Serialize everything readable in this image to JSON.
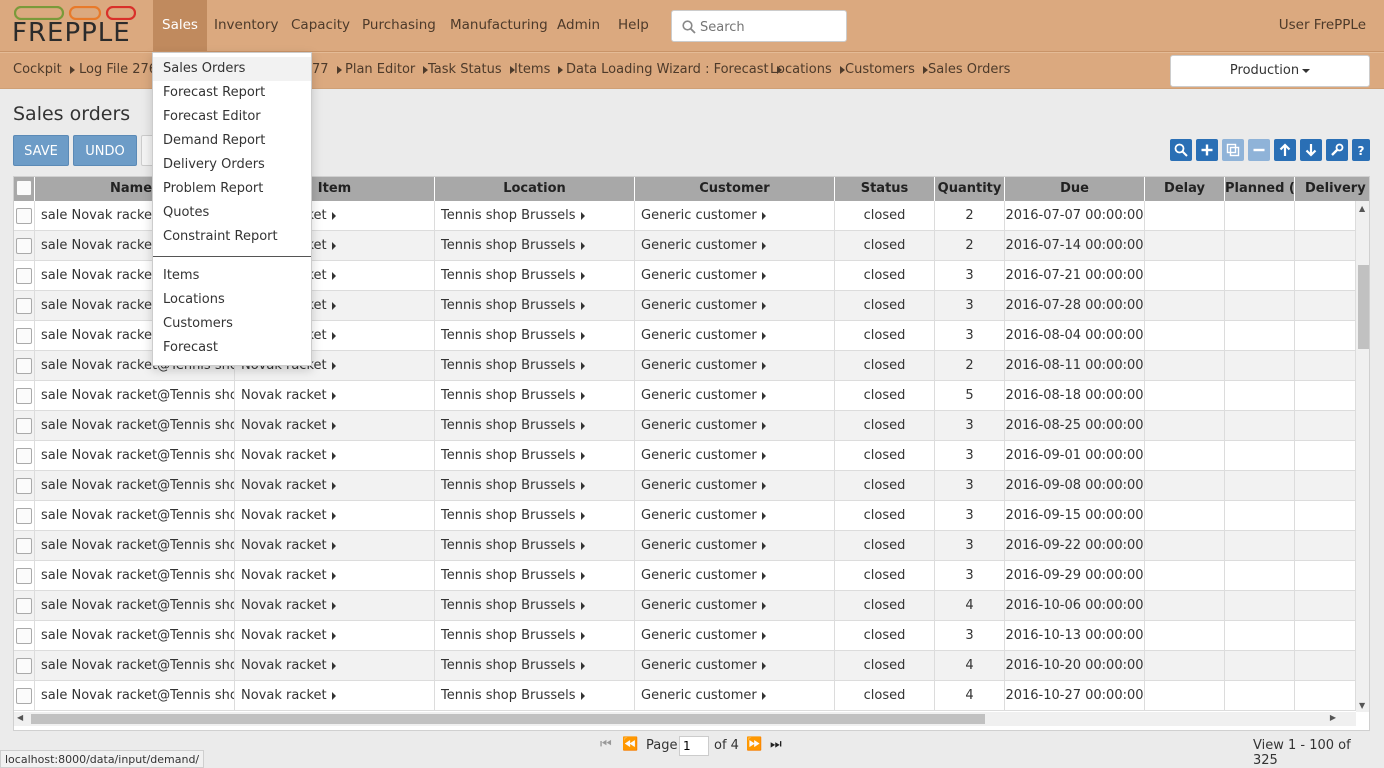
{
  "app": {
    "logo_text": "FREPPLE",
    "logo_ring_colors": [
      "#7a9a3a",
      "#e87a2a",
      "#d9302a"
    ]
  },
  "nav": {
    "items": [
      "Sales",
      "Inventory",
      "Capacity",
      "Purchasing",
      "Manufacturing",
      "Admin",
      "Help"
    ],
    "active": "Sales",
    "search_placeholder": "Search",
    "user": "User FrePPLe"
  },
  "breadcrumbs": {
    "items": [
      "Cockpit",
      "Log File 276",
      "77",
      "Plan Editor",
      "Task Status",
      "Items",
      "Data Loading Wizard : Forecast",
      "Locations",
      "Customers",
      "Sales Orders"
    ],
    "scenario": "Production"
  },
  "page": {
    "title": "Sales orders",
    "save_label": "SAVE",
    "undo_label": "UNDO"
  },
  "toolbar": {
    "icons": [
      "search-icon",
      "add-icon",
      "copy-icon",
      "delete-icon",
      "sort-up-icon",
      "sort-down-icon",
      "wrench-icon",
      "help-icon"
    ],
    "accent_color": "#2a6fb5"
  },
  "menu": {
    "group1": [
      "Sales Orders",
      "Forecast Report",
      "Forecast Editor",
      "Demand Report",
      "Delivery Orders",
      "Problem Report",
      "Quotes",
      "Constraint Report"
    ],
    "group2": [
      "Items",
      "Locations",
      "Customers",
      "Forecast"
    ],
    "highlighted": "Sales Orders"
  },
  "grid": {
    "columns": [
      "Name",
      "Item",
      "Location",
      "Customer",
      "Status",
      "Quantity",
      "Due",
      "Delay",
      "Planned (",
      "Delivery"
    ],
    "rows": [
      {
        "name": "sale Novak racket@Tennis shop",
        "item": "Novak racket",
        "location": "Tennis shop Brussels",
        "customer": "Generic customer",
        "status": "closed",
        "quantity": "2",
        "due": "2016-07-07 00:00:00"
      },
      {
        "name": "sale Novak racket@Tennis shop",
        "item": "Novak racket",
        "location": "Tennis shop Brussels",
        "customer": "Generic customer",
        "status": "closed",
        "quantity": "2",
        "due": "2016-07-14 00:00:00"
      },
      {
        "name": "sale Novak racket@Tennis shop",
        "item": "Novak racket",
        "location": "Tennis shop Brussels",
        "customer": "Generic customer",
        "status": "closed",
        "quantity": "3",
        "due": "2016-07-21 00:00:00"
      },
      {
        "name": "sale Novak racket@Tennis shop",
        "item": "Novak racket",
        "location": "Tennis shop Brussels",
        "customer": "Generic customer",
        "status": "closed",
        "quantity": "3",
        "due": "2016-07-28 00:00:00"
      },
      {
        "name": "sale Novak racket@Tennis shop",
        "item": "Novak racket",
        "location": "Tennis shop Brussels",
        "customer": "Generic customer",
        "status": "closed",
        "quantity": "3",
        "due": "2016-08-04 00:00:00"
      },
      {
        "name": "sale Novak racket@Tennis shop",
        "item": "Novak racket",
        "location": "Tennis shop Brussels",
        "customer": "Generic customer",
        "status": "closed",
        "quantity": "2",
        "due": "2016-08-11 00:00:00"
      },
      {
        "name": "sale Novak racket@Tennis shop",
        "item": "Novak racket",
        "location": "Tennis shop Brussels",
        "customer": "Generic customer",
        "status": "closed",
        "quantity": "5",
        "due": "2016-08-18 00:00:00"
      },
      {
        "name": "sale Novak racket@Tennis shop",
        "item": "Novak racket",
        "location": "Tennis shop Brussels",
        "customer": "Generic customer",
        "status": "closed",
        "quantity": "3",
        "due": "2016-08-25 00:00:00"
      },
      {
        "name": "sale Novak racket@Tennis shop",
        "item": "Novak racket",
        "location": "Tennis shop Brussels",
        "customer": "Generic customer",
        "status": "closed",
        "quantity": "3",
        "due": "2016-09-01 00:00:00"
      },
      {
        "name": "sale Novak racket@Tennis shop",
        "item": "Novak racket",
        "location": "Tennis shop Brussels",
        "customer": "Generic customer",
        "status": "closed",
        "quantity": "3",
        "due": "2016-09-08 00:00:00"
      },
      {
        "name": "sale Novak racket@Tennis shop",
        "item": "Novak racket",
        "location": "Tennis shop Brussels",
        "customer": "Generic customer",
        "status": "closed",
        "quantity": "3",
        "due": "2016-09-15 00:00:00"
      },
      {
        "name": "sale Novak racket@Tennis shop",
        "item": "Novak racket",
        "location": "Tennis shop Brussels",
        "customer": "Generic customer",
        "status": "closed",
        "quantity": "3",
        "due": "2016-09-22 00:00:00"
      },
      {
        "name": "sale Novak racket@Tennis shop",
        "item": "Novak racket",
        "location": "Tennis shop Brussels",
        "customer": "Generic customer",
        "status": "closed",
        "quantity": "3",
        "due": "2016-09-29 00:00:00"
      },
      {
        "name": "sale Novak racket@Tennis shop",
        "item": "Novak racket",
        "location": "Tennis shop Brussels",
        "customer": "Generic customer",
        "status": "closed",
        "quantity": "4",
        "due": "2016-10-06 00:00:00"
      },
      {
        "name": "sale Novak racket@Tennis shop",
        "item": "Novak racket",
        "location": "Tennis shop Brussels",
        "customer": "Generic customer",
        "status": "closed",
        "quantity": "3",
        "due": "2016-10-13 00:00:00"
      },
      {
        "name": "sale Novak racket@Tennis shop",
        "item": "Novak racket",
        "location": "Tennis shop Brussels",
        "customer": "Generic customer",
        "status": "closed",
        "quantity": "4",
        "due": "2016-10-20 00:00:00"
      },
      {
        "name": "sale Novak racket@Tennis shop",
        "item": "Novak racket",
        "location": "Tennis shop Brussels",
        "customer": "Generic customer",
        "status": "closed",
        "quantity": "4",
        "due": "2016-10-27 00:00:00"
      }
    ]
  },
  "pager": {
    "page_label": "Page",
    "page_value": "1",
    "of_label": "of 4",
    "view_label": "View 1 - 100 of 325"
  },
  "statusbar": {
    "url": "localhost:8000/data/input/demand/"
  }
}
